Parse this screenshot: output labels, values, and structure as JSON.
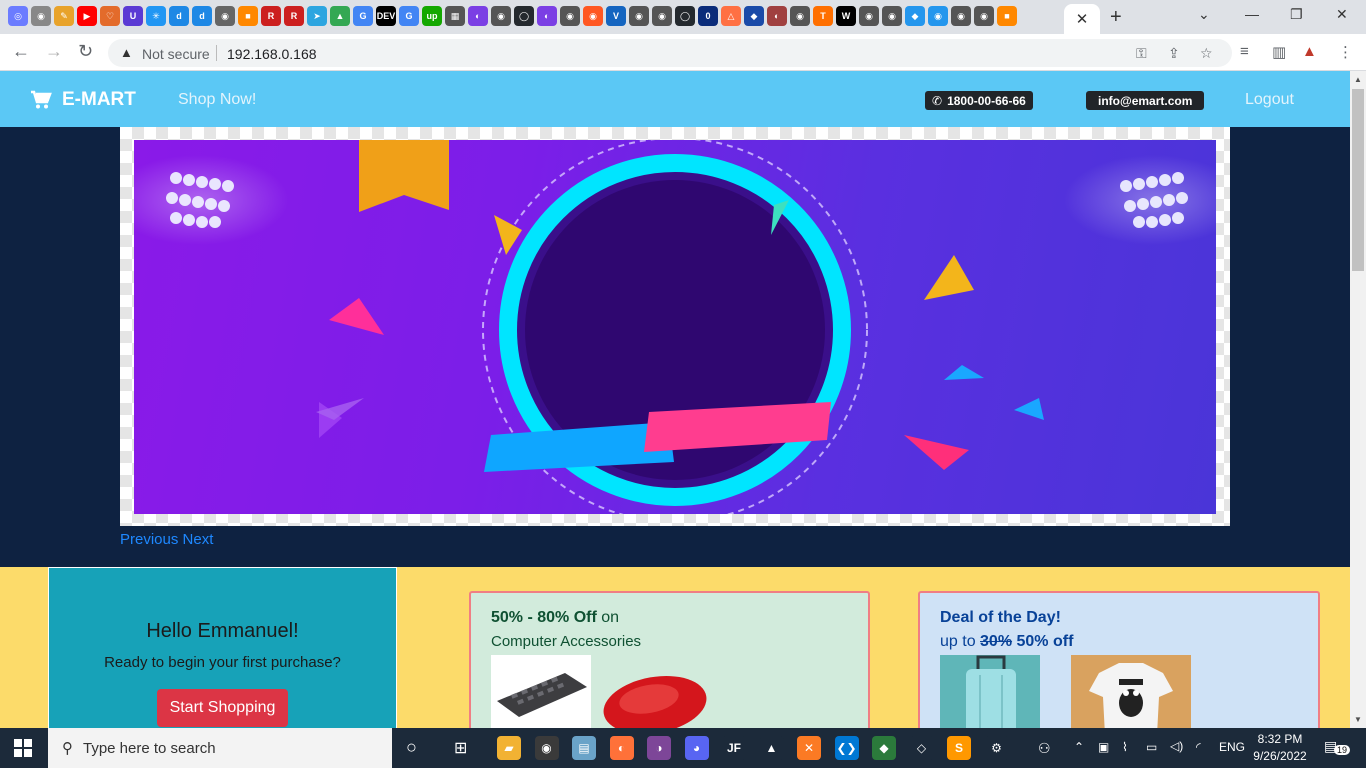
{
  "browser": {
    "security_label": "Not secure",
    "url": "192.168.0.168",
    "tab_favicons": [
      "#6b7cff",
      "#888",
      "#e8a32b",
      "#ff0000",
      "#e36b2b",
      "#5a3ad4",
      "#2196f3",
      "#1e88e5",
      "#1e88e5",
      "#666",
      "#ff8800",
      "#cc1f1f",
      "#cc1f1f",
      "#2ca5e0",
      "#34a853",
      "#4285f4",
      "#000",
      "#4285f4",
      "#14a800",
      "#555",
      "#7b3fe4",
      "#555",
      "#24292e",
      "#7b3fe4",
      "#555",
      "#ff5722",
      "#1565c0",
      "#555",
      "#555",
      "#24292e",
      "#0b2c7a",
      "#ff7043",
      "#1a4aa8",
      "#a04040",
      "#555",
      "#ff6f00",
      "#000",
      "#555",
      "#555",
      "#2496ed",
      "#2496ed",
      "#555",
      "#555",
      "#ff8800"
    ],
    "tab_favicon_labels": [
      "◎",
      "◉",
      "✎",
      "▶",
      "♡",
      "U",
      "✳",
      "d",
      "d",
      "◉",
      "■",
      "R",
      "R",
      "➤",
      "▲",
      "G",
      "DEV",
      "G",
      "up",
      "▦",
      "◐",
      "◉",
      "◯",
      "◐",
      "◉",
      "◉",
      "V",
      "◉",
      "◉",
      "◯",
      "0",
      "△",
      "◆",
      "◐",
      "◉",
      "T",
      "W",
      "◉",
      "◉",
      "◆",
      "◉",
      "◉",
      "◉",
      "■"
    ]
  },
  "navbar": {
    "brand": "E-MART",
    "shop_now": "Shop Now!",
    "phone": "1800-00-66-66",
    "email": "info@emart.com",
    "logout": "Logout"
  },
  "carousel": {
    "previous": "Previous",
    "next": "Next"
  },
  "hello_card": {
    "title": "Hello Emmanuel!",
    "subtitle": "Ready to begin your first purchase?",
    "button": "Start Shopping"
  },
  "accessories_card": {
    "discount": "50% - 80% Off",
    "on": " on",
    "category": "Computer Accessories"
  },
  "deal_card": {
    "title": "Deal of the Day!",
    "prefix": "up to ",
    "old_value": "30%",
    "new_value": " 50% off"
  },
  "taskbar": {
    "search_placeholder": "Type here to search",
    "language": "ENG",
    "time": "8:32 PM",
    "date": "9/26/2022",
    "notifications": "19",
    "apps": [
      {
        "name": "file-explorer",
        "color": "#f2b233",
        "glyph": "▰"
      },
      {
        "name": "chrome",
        "color": "#3a3a3a",
        "glyph": "◉"
      },
      {
        "name": "notepad",
        "color": "#6aa3c8",
        "glyph": "▤"
      },
      {
        "name": "firefox",
        "color": "#ff7139",
        "glyph": "◐"
      },
      {
        "name": "tor",
        "color": "#7d4698",
        "glyph": "◑"
      },
      {
        "name": "discord",
        "color": "#5865f2",
        "glyph": "◕"
      },
      {
        "name": "jetbrains",
        "color": "#1c2a3a",
        "glyph": "JF"
      },
      {
        "name": "alpari",
        "color": "#1c2a3a",
        "glyph": "▲"
      },
      {
        "name": "xampp",
        "color": "#fb7a24",
        "glyph": "✕"
      },
      {
        "name": "vscode",
        "color": "#0078d4",
        "glyph": "❮❯"
      },
      {
        "name": "git",
        "color": "#2b7a3b",
        "glyph": "◆"
      },
      {
        "name": "virtualbox",
        "color": "#1c2a3a",
        "glyph": "◇"
      },
      {
        "name": "sublime",
        "color": "#ff9800",
        "glyph": "S"
      },
      {
        "name": "settings",
        "color": "#1c2a3a",
        "glyph": "⚙"
      }
    ]
  }
}
